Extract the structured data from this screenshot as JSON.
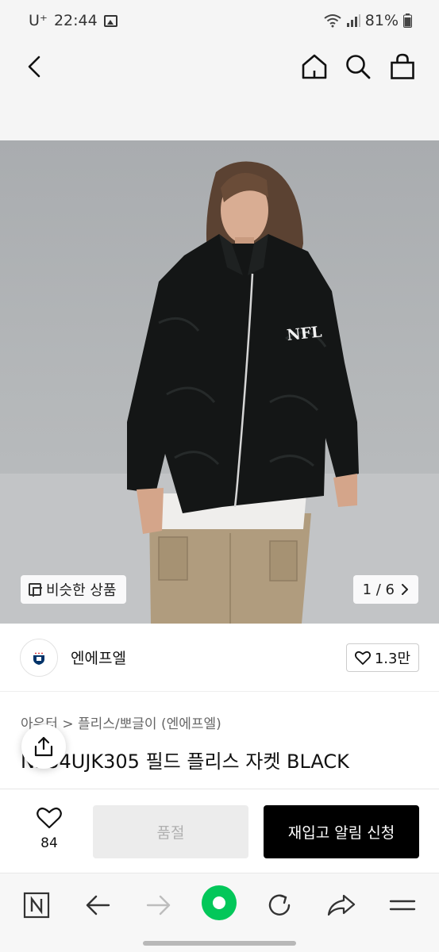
{
  "status_bar": {
    "carrier": "U⁺",
    "time": "22:44",
    "battery": "81%"
  },
  "top_nav": {
    "back_icon": "back-arrow-icon",
    "home_icon": "home-icon",
    "search_icon": "search-icon",
    "cart_icon": "shopping-bag-icon"
  },
  "hero": {
    "similar_label": "비슷한 상품",
    "page_indicator": "1 / 6",
    "logo_text": "NFL"
  },
  "brand": {
    "name": "엔에프엘",
    "likes": "1.3만"
  },
  "product": {
    "breadcrumb": "아우터 > 플리스/뽀글이 (엔에프엘)",
    "title": "N234UJK305 필드 플리스 자켓 BLACK"
  },
  "actions": {
    "wish_count": "84",
    "soldout_label": "품절",
    "restock_label": "재입고 알림 신청"
  },
  "colors": {
    "accent_green": "#03c75a",
    "primary_black": "#000000",
    "disabled_gray": "#ececec"
  }
}
